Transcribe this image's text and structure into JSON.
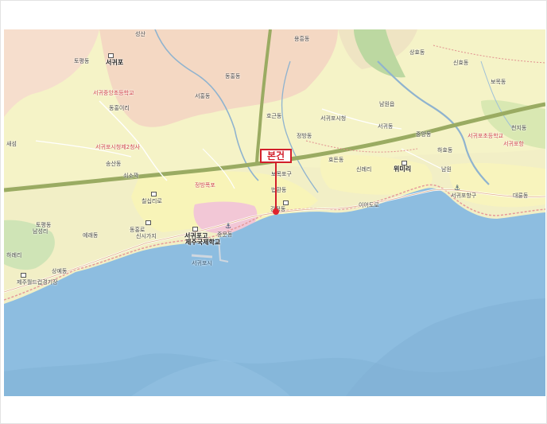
{
  "marker": {
    "label": "본건"
  },
  "labels": {
    "l01": "성산",
    "l02": "용흥동",
    "l03": "서귀포",
    "l04": "토평동",
    "l05": "서귀중앙초등학교",
    "l06": "동홍동",
    "l07": "동홍이리",
    "l08": "상효동",
    "l09": "신효동",
    "l10": "보목동",
    "l11": "서홍동",
    "l12": "호근동",
    "l13": "서귀포시청",
    "l14": "서귀포시청제2청사",
    "l15": "남원읍",
    "l16": "서귀포초등학교",
    "l17": "천지동",
    "l18": "정방동",
    "l19": "서귀동",
    "l20": "중앙동",
    "l21": "송산동",
    "l22": "서귀포항",
    "l23": "새섬",
    "l24": "하효동",
    "l25": "효돈동",
    "l26": "쇠소깍",
    "l27": "신례리",
    "l28": "위미리",
    "l29": "남원",
    "l30": "정방폭포",
    "l31": "칠십리로",
    "l32": "보목포구",
    "l33": "서귀포항구",
    "l34": "대륜동",
    "l35": "법환동",
    "l36": "강정동",
    "l37": "이어도로",
    "l38": "토평동",
    "l39": "남성리",
    "l40": "동홍로",
    "l41": "신시가지",
    "l42": "서귀포고",
    "l43": "제주국제학교",
    "l44": "중문동",
    "l45": "예래동",
    "l46": "하례리",
    "l47": "서귀포시",
    "l48": "상예동",
    "l49": "제주월드컵경기장"
  }
}
